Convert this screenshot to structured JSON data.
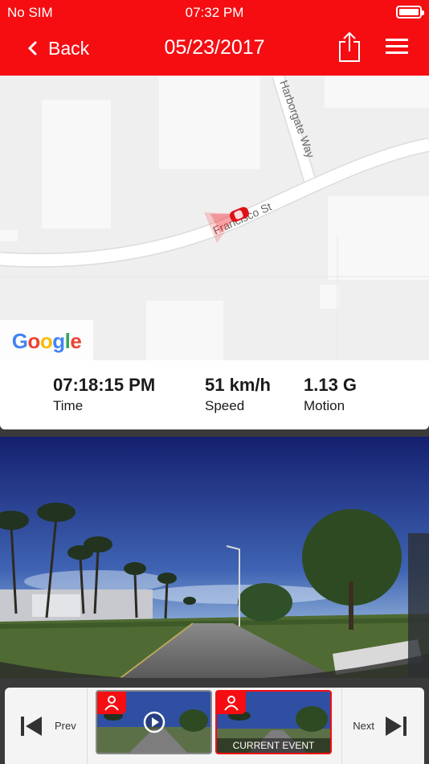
{
  "status_bar": {
    "carrier": "No SIM",
    "time": "07:32 PM"
  },
  "nav": {
    "back_label": "Back",
    "title": "05/23/2017"
  },
  "map": {
    "street_1": "Francisco St",
    "street_2": "Harborgate Way",
    "provider": "Google",
    "provider_letters": [
      "G",
      "o",
      "o",
      "g",
      "l",
      "e"
    ],
    "provider_colors": [
      "#4285F4",
      "#EA4335",
      "#FBBC05",
      "#4285F4",
      "#34A853",
      "#EA4335"
    ]
  },
  "stats": {
    "time_value": "07:18:15 PM",
    "time_label": "Time",
    "speed_value": "51 km/h",
    "speed_label": "Speed",
    "motion_value": "1.13 G",
    "motion_label": "Motion"
  },
  "strip": {
    "prev_label": "Prev",
    "next_label": "Next",
    "current_caption": "CURRENT EVENT"
  },
  "colors": {
    "accent": "#f50d12"
  }
}
